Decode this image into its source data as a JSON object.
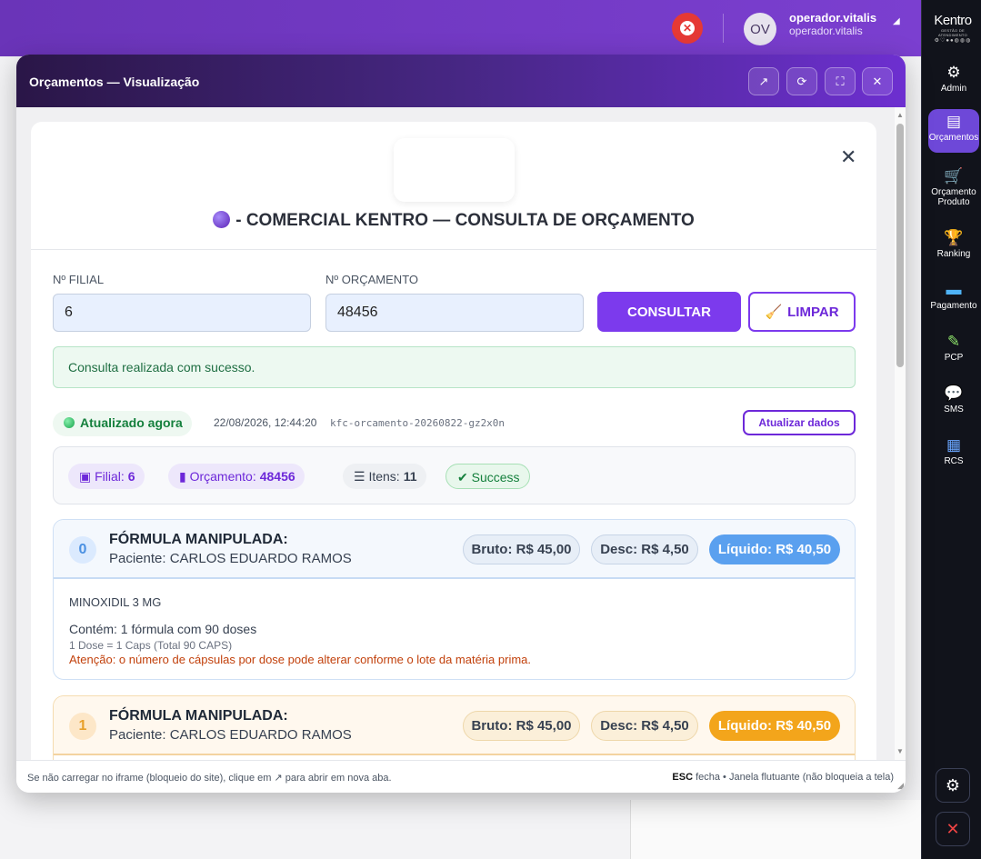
{
  "topbar": {
    "user_name": "operador.vitalis",
    "user_sub": "operador.vitalis",
    "avatar_initials": "OV"
  },
  "rail": {
    "logo_text": "Kentro",
    "logo_sub": "GESTÃO DE ATENDIMENTO",
    "items": [
      {
        "label": "Admin",
        "icon": "gear-icon"
      },
      {
        "label": "Orçamentos",
        "icon": "document-icon"
      },
      {
        "label": "Orçamento Produto",
        "icon": "cart-icon"
      },
      {
        "label": "Ranking",
        "icon": "trophy-icon"
      },
      {
        "label": "Pagamento",
        "icon": "card-icon"
      },
      {
        "label": "PCP",
        "icon": "test-tube-icon"
      },
      {
        "label": "SMS",
        "icon": "chat-bubble-icon"
      },
      {
        "label": "RCS",
        "icon": "phone-icon"
      }
    ]
  },
  "window": {
    "title": "Orçamentos — Visualização",
    "footer_left": "Se não carregar no iframe (bloqueio do site), clique em ↗ para abrir em nova aba.",
    "footer_key": "ESC",
    "footer_right": "fecha • Janela flutuante (não bloqueia a tela)"
  },
  "form": {
    "title": "- COMERCIAL KENTRO — CONSULTA DE ORÇAMENTO",
    "filial_label": "Nº FILIAL",
    "filial_value": "6",
    "orcamento_label": "Nº ORÇAMENTO",
    "orcamento_value": "48456",
    "consultar_label": "CONSULTAR",
    "limpar_label": "LIMPAR",
    "success_msg": "Consulta realizada com sucesso."
  },
  "status": {
    "updated_label": "Atualizado agora",
    "timestamp": "22/08/2026, 12:44:20",
    "request_id": "kfc-orcamento-20260822-gz2x0n",
    "refresh_label": "Atualizar dados"
  },
  "summary": {
    "filial_label": "Filial:",
    "filial_value": "6",
    "orcamento_label": "Orçamento:",
    "orcamento_value": "48456",
    "itens_label": "Itens:",
    "itens_value": "11",
    "status_label": "Success"
  },
  "items": [
    {
      "index": "0",
      "title": "FÓRMULA MANIPULADA:",
      "patient": "Paciente: CARLOS EDUARDO RAMOS",
      "bruto": "Bruto: R$ 45,00",
      "desc": "Desc: R$ 4,50",
      "liquido": "Líquido: R$ 40,50",
      "product": "MINOXIDIL 3 MG",
      "contains": "Contém: 1 fórmula com 90 doses",
      "dose": "1 Dose = 1 Caps (Total 90 CAPS)",
      "warning": "Atenção: o número de cápsulas por dose pode alterar conforme o lote da matéria prima."
    },
    {
      "index": "1",
      "title": "FÓRMULA MANIPULADA:",
      "patient": "Paciente: CARLOS EDUARDO RAMOS",
      "bruto": "Bruto: R$ 45,00",
      "desc": "Desc: R$ 4,50",
      "liquido": "Líquido: R$ 40,50"
    }
  ]
}
